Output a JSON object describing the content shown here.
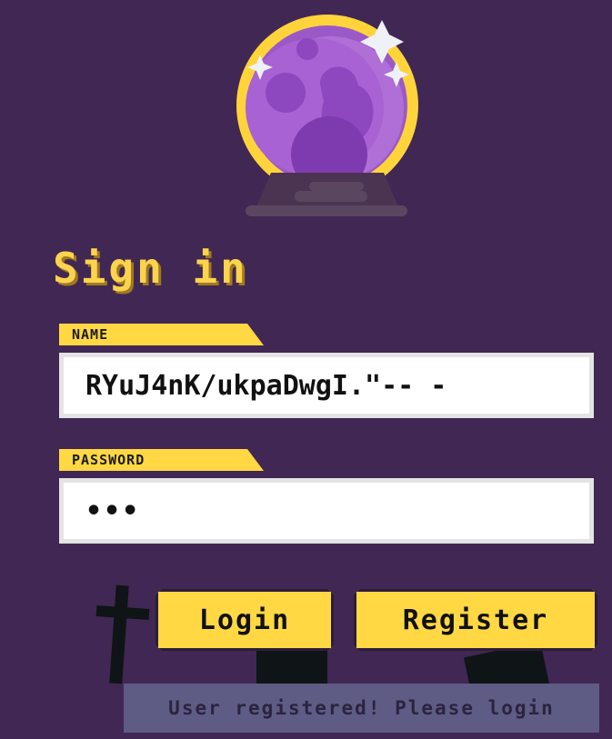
{
  "page": {
    "title": "Sign in"
  },
  "form": {
    "name_label": "NAME",
    "name_value": "RYuJ4nK/ukpaDwgI.\"-- -",
    "password_label": "PASSWORD",
    "password_value": "•••"
  },
  "buttons": {
    "login": "Login",
    "register": "Register"
  },
  "toast": {
    "message": "User registered! Please login"
  },
  "icons": {
    "logo": "crystal-ball-icon",
    "decor": [
      "cross-icon",
      "tombstone-icon"
    ]
  },
  "colors": {
    "background": "#412753",
    "accent": "#ffd843",
    "toast_bg": "#5e5b84"
  }
}
